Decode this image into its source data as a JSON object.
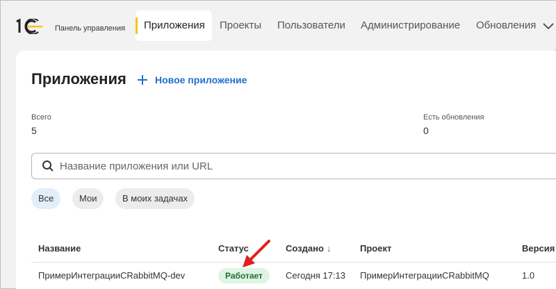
{
  "header": {
    "brand": "1C",
    "panel_label": "Панель управления",
    "tabs": [
      {
        "label": "Приложения",
        "active": true
      },
      {
        "label": "Проекты",
        "active": false
      },
      {
        "label": "Пользователи",
        "active": false
      },
      {
        "label": "Администрирование",
        "active": false
      },
      {
        "label": "Обновления",
        "active": false
      }
    ],
    "more_icon": "chevron-down-icon"
  },
  "main": {
    "title": "Приложения",
    "new_app_label": "Новое приложение",
    "stats": {
      "total_label": "Всего",
      "total_value": "5",
      "updates_label": "Есть обновления",
      "updates_value": "0"
    },
    "search": {
      "placeholder": "Название приложения или URL",
      "value": ""
    },
    "filters": [
      {
        "label": "Все",
        "active": true
      },
      {
        "label": "Мои",
        "active": false
      },
      {
        "label": "В моих задачах",
        "active": false
      }
    ],
    "table": {
      "columns": [
        "Название",
        "Статус",
        "Создано",
        "Проект",
        "Версия"
      ],
      "sort_indicator": "↓",
      "rows": [
        {
          "name": "ПримерИнтеграцииCRabbitMQ-dev",
          "status": "Работает",
          "created": "Сегодня 17:13",
          "project": "ПримерИнтеграцииCRabbitMQ",
          "version": "1.0"
        }
      ]
    }
  },
  "colors": {
    "accent_blue": "#1f6fd0",
    "logo_yellow": "#f5c518",
    "status_green_bg": "#dff4e4",
    "arrow_red": "#e02020"
  }
}
